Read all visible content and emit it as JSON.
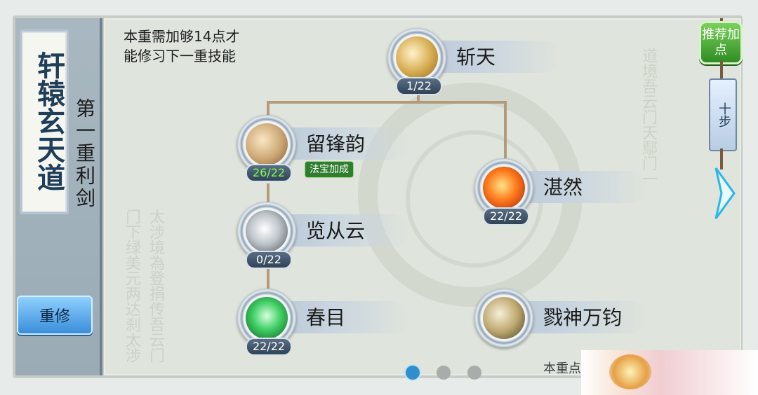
{
  "left": {
    "title": "轩辕玄天道",
    "chapter": "第一重利剑",
    "reset_button": "重修"
  },
  "hint": {
    "line1": "本重需加够14点才",
    "line2": "能修习下一重技能"
  },
  "skills": [
    {
      "id": "zhantian",
      "name": "斩天",
      "level": "1/22"
    },
    {
      "id": "liufengyun",
      "name": "留锋韵",
      "level": "26/22",
      "tag": "法宝加成"
    },
    {
      "id": "zhanran",
      "name": "湛然",
      "level": "22/22"
    },
    {
      "id": "lancongyun",
      "name": "览从云",
      "level": "0/22"
    },
    {
      "id": "chunmu",
      "name": "春目",
      "level": "22/22"
    },
    {
      "id": "lushenwanjun",
      "name": "戮神万钧",
      "level": ""
    }
  ],
  "right": {
    "recommend_button": "推荐加点",
    "step_button": "十步"
  },
  "pager": {
    "count": 3,
    "active": 0
  },
  "bottom_text": "本重点",
  "colors": {
    "accent": "#2f8fcb",
    "tag_green": "#2f7d2e",
    "level_highlight": "#7dff4a"
  }
}
